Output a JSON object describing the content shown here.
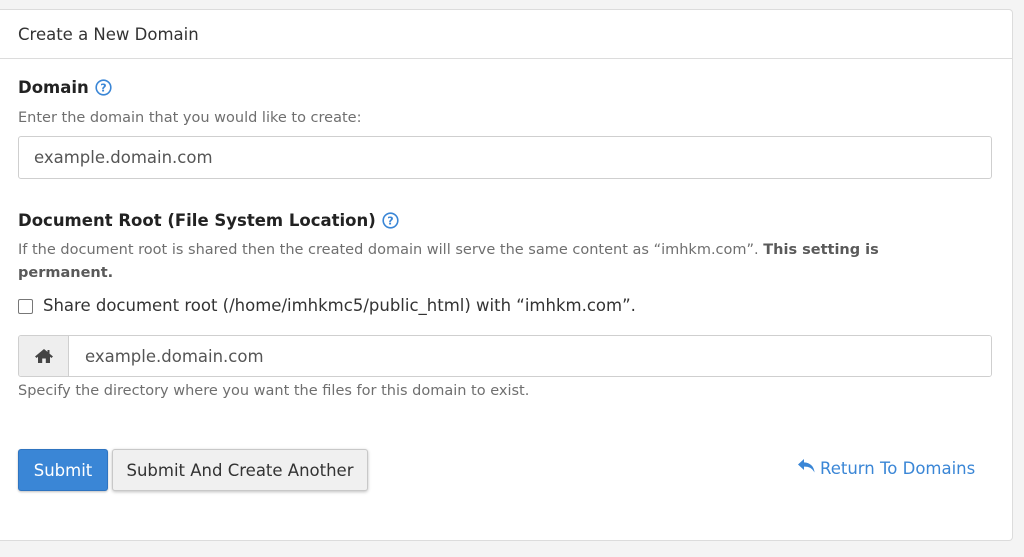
{
  "panel": {
    "title": "Create a New Domain"
  },
  "domain": {
    "label": "Domain",
    "hint": "Enter the domain that you would like to create:",
    "value": "example.domain.com"
  },
  "docroot": {
    "label": "Document Root (File System Location)",
    "hint_text": "If the document root is shared then the created domain will serve the same content as “imhkm.com”.",
    "hint_strong": "This setting is permanent.",
    "share_checkbox_label": "Share document root (/home/imhkmc5/public_html) with “imhkm.com”.",
    "share_checked": false,
    "path_value": "example.domain.com",
    "path_hint": "Specify the directory where you want the files for this domain to exist."
  },
  "actions": {
    "submit_label": "Submit",
    "submit_another_label": "Submit And Create Another",
    "return_label": "Return To Domains"
  },
  "icons": {
    "help": "question-circle-icon",
    "home": "home-icon",
    "return": "reply-arrow-icon"
  },
  "colors": {
    "accent": "#3a86d6",
    "help_icon": "#3a86d6"
  }
}
